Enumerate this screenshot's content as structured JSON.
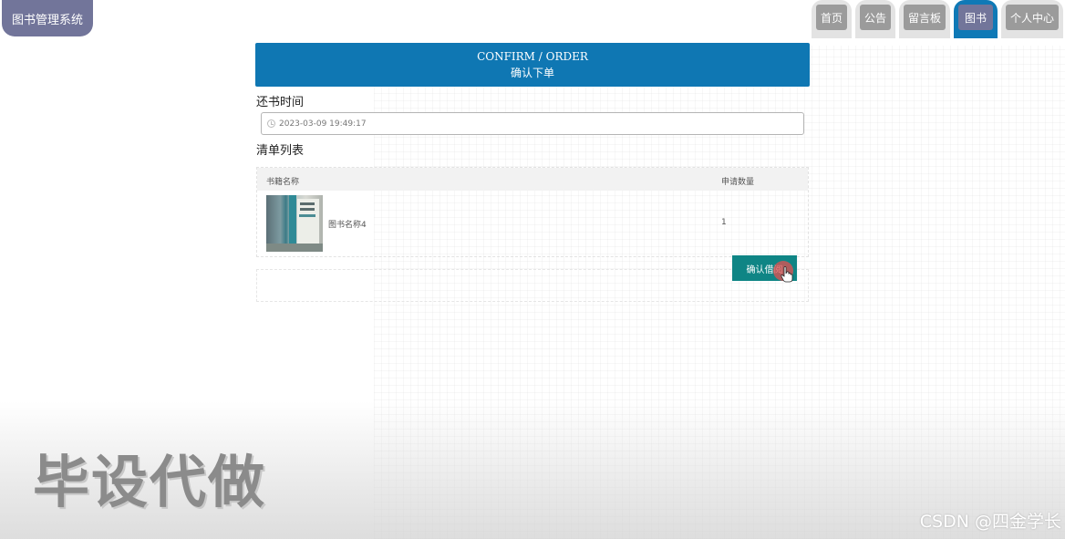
{
  "brand": {
    "title": "图书管理系统"
  },
  "nav": {
    "tabs": [
      {
        "label": "首页",
        "active": false
      },
      {
        "label": "公告",
        "active": false
      },
      {
        "label": "留言板",
        "active": false
      },
      {
        "label": "图书",
        "active": true
      },
      {
        "label": "个人中心",
        "active": false
      }
    ]
  },
  "banner": {
    "title_en": "CONFIRM / ORDER",
    "title_cn": "确认下单"
  },
  "return_time": {
    "label": "还书时间",
    "value": "2023-03-09 19:49:17",
    "icon": "clock-icon"
  },
  "list": {
    "label": "清单列表",
    "columns": [
      "书籍名称",
      "申请数量"
    ],
    "rows": [
      {
        "name": "图书名称4",
        "quantity": "1"
      }
    ]
  },
  "actions": {
    "confirm_label": "确认借阅"
  },
  "watermarks": {
    "promo": "毕设代做",
    "source": "CSDN @四金学长"
  },
  "colors": {
    "brand": "#72759a",
    "banner": "#0f77b3",
    "confirm_button": "#0f8585",
    "nav_active": "#0f79b6"
  }
}
